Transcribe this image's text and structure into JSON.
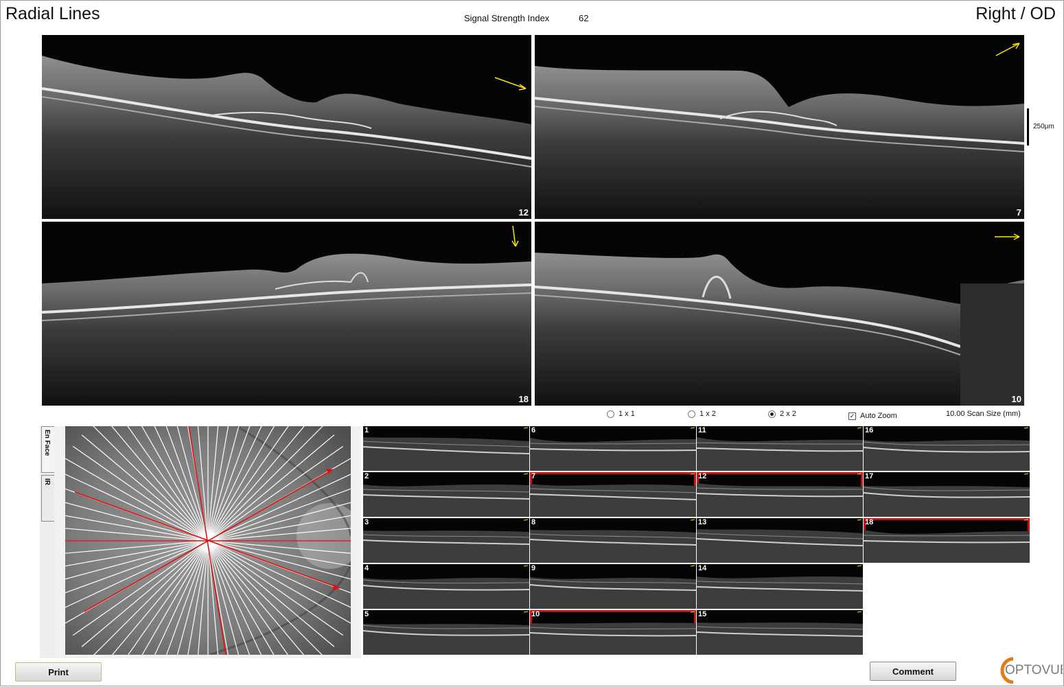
{
  "header": {
    "title": "Radial Lines",
    "eye": "Right / OD",
    "signal_strength_label": "Signal Strength Index",
    "signal_strength_value": "62"
  },
  "bscans": [
    {
      "number": "12",
      "arrow": "down-right"
    },
    {
      "number": "7",
      "arrow": "up-right"
    },
    {
      "number": "18",
      "arrow": "down"
    },
    {
      "number": "10",
      "arrow": "right"
    }
  ],
  "scale": {
    "label": "250µm"
  },
  "layout_options": [
    {
      "label": "1 x 1",
      "selected": false
    },
    {
      "label": "1 x 2",
      "selected": false
    },
    {
      "label": "2 x 2",
      "selected": true
    }
  ],
  "auto_zoom": {
    "label": "Auto Zoom",
    "checked": true
  },
  "scan_size": "10.00 Scan Size (mm)",
  "side_tabs": {
    "en_face": "En Face",
    "ir": "IR"
  },
  "thumbnails": [
    "1",
    "2",
    "3",
    "4",
    "5",
    "6",
    "7",
    "8",
    "9",
    "10",
    "11",
    "12",
    "13",
    "14",
    "15",
    "16",
    "17",
    "18"
  ],
  "selected_scans": [
    "7",
    "10",
    "12",
    "18"
  ],
  "buttons": {
    "print": "Print",
    "comment": "Comment"
  },
  "logo": "OPTOVUE",
  "colors": {
    "selection": "#cc0f0f",
    "arrow": "#ffe600",
    "logo_ring": "#e87a12",
    "logo_text": "#7a7a7a"
  }
}
